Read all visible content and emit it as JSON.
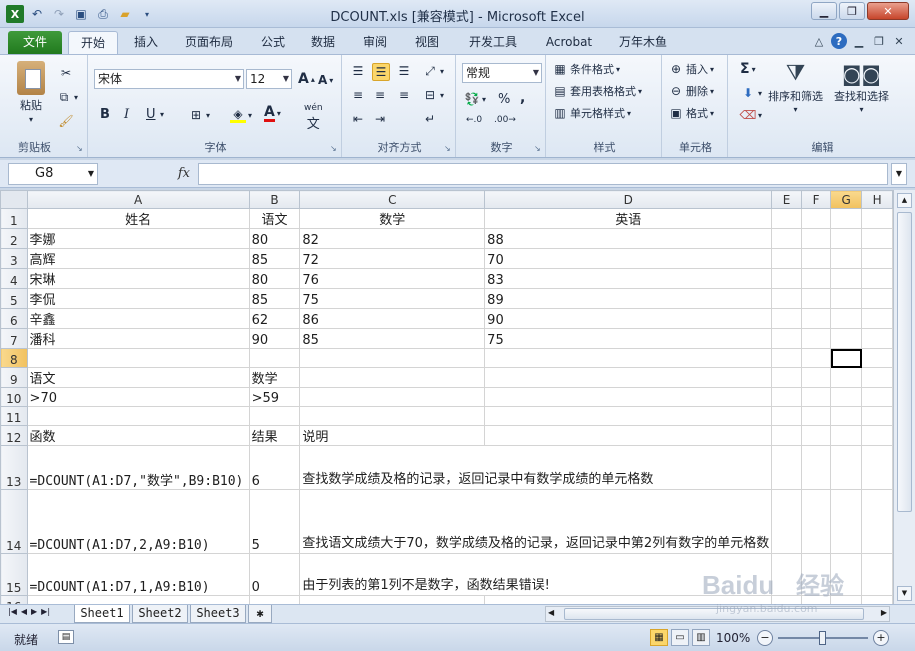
{
  "window": {
    "title": "DCOUNT.xls  [兼容模式]  -  Microsoft Excel"
  },
  "tabs": [
    "文件",
    "开始",
    "插入",
    "页面布局",
    "公式",
    "数据",
    "审阅",
    "视图",
    "开发工具",
    "Acrobat",
    "万年木鱼"
  ],
  "ribbon": {
    "clipboard": {
      "paste": "粘贴",
      "label": "剪贴板"
    },
    "font": {
      "name": "宋体",
      "size": "12",
      "bold": "B",
      "italic": "I",
      "underline": "U",
      "label": "字体",
      "grow": "A",
      "shrink": "A",
      "wen": "wén"
    },
    "alignment": {
      "label": "对齐方式"
    },
    "number": {
      "format": "常规",
      "percent": "%",
      "comma": ",",
      "label": "数字"
    },
    "styles": {
      "conditional": "条件格式",
      "table": "套用表格格式",
      "cell": "单元格样式",
      "label": "样式"
    },
    "cells": {
      "insert": "插入",
      "delete": "删除",
      "format": "格式",
      "label": "单元格"
    },
    "editing": {
      "sum": "Σ",
      "sort": "排序和筛选",
      "find": "查找和选择",
      "label": "编辑"
    }
  },
  "formula_bar": {
    "name_box": "G8",
    "fx": "fx",
    "content": ""
  },
  "sheet": {
    "columns": [
      "A",
      "B",
      "C",
      "D",
      "E",
      "F",
      "G",
      "H"
    ],
    "selected_column": "G",
    "selected_row": "8",
    "rows": [
      {
        "num": "1",
        "cells": [
          "姓名",
          "语文",
          "数学",
          "英语",
          "",
          "",
          "",
          ""
        ]
      },
      {
        "num": "2",
        "cells": [
          "李娜",
          "80",
          "82",
          "88",
          "",
          "",
          "",
          ""
        ]
      },
      {
        "num": "3",
        "cells": [
          "高辉",
          "85",
          "72",
          "70",
          "",
          "",
          "",
          ""
        ]
      },
      {
        "num": "4",
        "cells": [
          "宋琳",
          "80",
          "76",
          "83",
          "",
          "",
          "",
          ""
        ]
      },
      {
        "num": "5",
        "cells": [
          "李侃",
          "85",
          "75",
          "89",
          "",
          "",
          "",
          ""
        ]
      },
      {
        "num": "6",
        "cells": [
          "辛鑫",
          "62",
          "86",
          "90",
          "",
          "",
          "",
          ""
        ]
      },
      {
        "num": "7",
        "cells": [
          "潘科",
          "90",
          "85",
          "75",
          "",
          "",
          "",
          ""
        ]
      },
      {
        "num": "8",
        "cells": [
          "",
          "",
          "",
          "",
          "",
          "",
          "",
          ""
        ]
      },
      {
        "num": "9",
        "cells": [
          "语文",
          "数学",
          "",
          "",
          "",
          "",
          "",
          ""
        ]
      },
      {
        "num": "10",
        "cells": [
          ">70",
          ">59",
          "",
          "",
          "",
          "",
          "",
          ""
        ]
      },
      {
        "num": "11",
        "cells": [
          "",
          "",
          "",
          "",
          "",
          "",
          "",
          ""
        ]
      },
      {
        "num": "12",
        "cells": [
          "函数",
          "结果",
          "说明",
          "",
          "",
          "",
          "",
          ""
        ]
      },
      {
        "num": "13",
        "cells": [
          "=DCOUNT(A1:D7,\"数学\",B9:B10)",
          "6",
          "查找数学成绩及格的记录，返回记录中有数学成绩的单元格数",
          "",
          "",
          "",
          "",
          ""
        ]
      },
      {
        "num": "14",
        "cells": [
          "=DCOUNT(A1:D7,2,A9:B10)",
          "5",
          "查找语文成绩大于70，数学成绩及格的记录，返回记录中第2列有数字的单元格数",
          "",
          "",
          "",
          "",
          ""
        ]
      },
      {
        "num": "15",
        "cells": [
          "=DCOUNT(A1:D7,1,A9:B10)",
          "0",
          "由于列表的第1列不是数字，函数结果错误!",
          "",
          "",
          "",
          "",
          ""
        ]
      },
      {
        "num": "16",
        "cells": [
          "",
          "",
          "",
          "",
          "",
          "",
          "",
          ""
        ]
      }
    ]
  },
  "sheet_tabs": [
    "Sheet1",
    "Sheet2",
    "Sheet3"
  ],
  "active_sheet": "Sheet1",
  "status": {
    "ready": "就绪",
    "zoom": "100%",
    "zoom_fraction": 0.5
  },
  "watermark": {
    "brand": "Baidu",
    "sub": "经验",
    "url": "jingyan.baidu.com"
  },
  "colors": {
    "file_tab": "#2a8a26",
    "selection_header": "#f1c15f",
    "active_align": "#fbd66a"
  }
}
